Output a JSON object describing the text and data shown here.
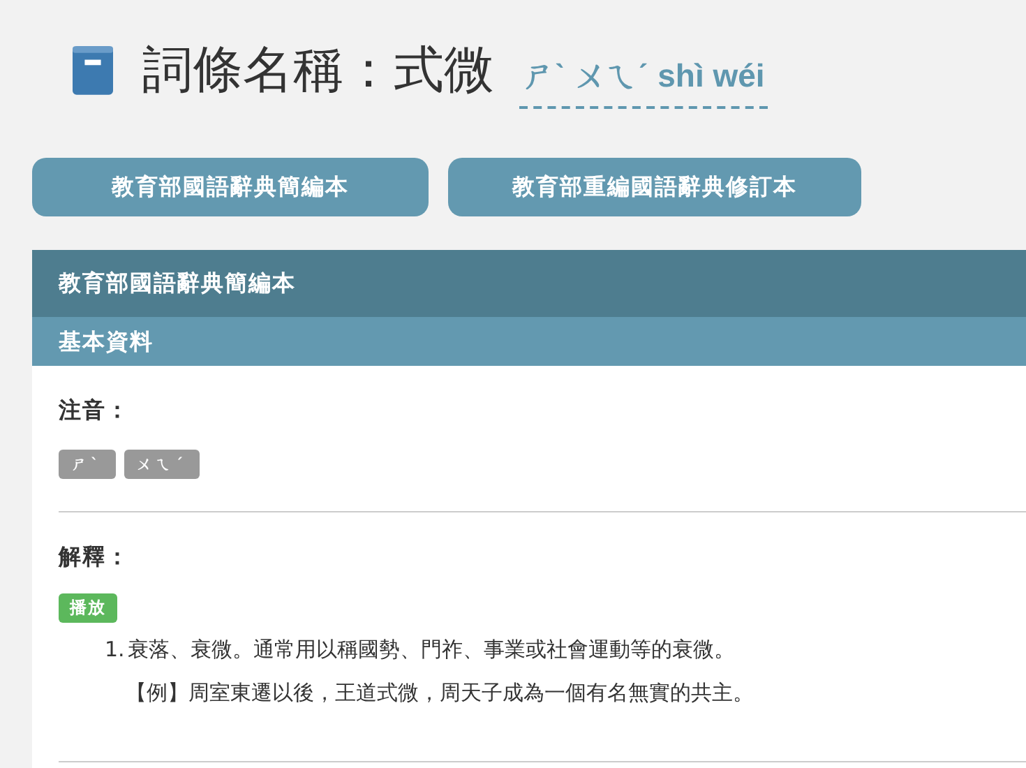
{
  "header": {
    "title": "詞條名稱：式微",
    "pronunciation": "ㄕˋ ㄨㄟˊ shì wéi"
  },
  "source_buttons": [
    "教育部國語辭典簡編本",
    "教育部重編國語辭典修訂本"
  ],
  "panel": {
    "title": "教育部國語辭典簡編本",
    "section": "基本資料",
    "zhuyin_label": "注音：",
    "zhuyin": [
      "ㄕˋ",
      "ㄨㄟˊ"
    ],
    "definition_label": "解釋：",
    "play_button": "播放",
    "definitions": [
      {
        "number": "1.",
        "text": "衰落、衰微。通常用以稱國勢、門祚、事業或社會運動等的衰微。",
        "example": "【例】周室東遷以後，王道式微，周天子成為一個有名無實的共主。"
      }
    ]
  }
}
